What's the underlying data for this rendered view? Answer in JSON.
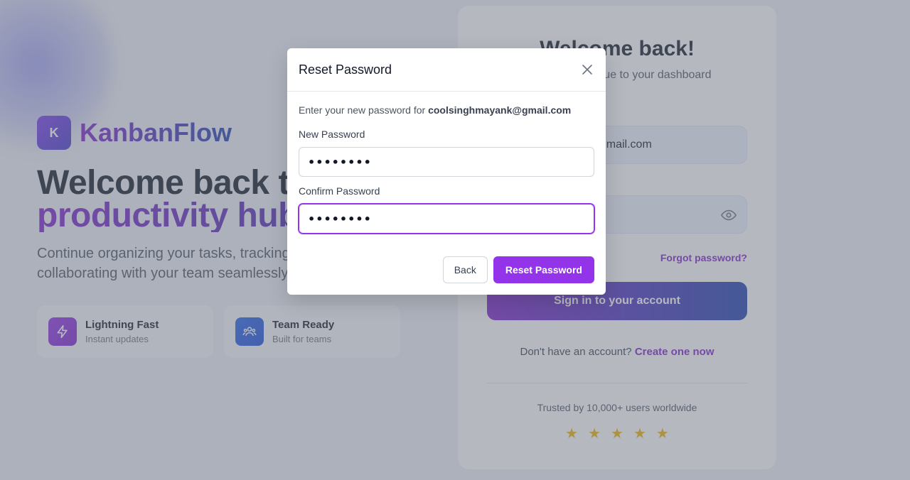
{
  "brand": {
    "logo_letter": "K",
    "name": "KanbanFlow"
  },
  "hero": {
    "title_line1": "Welcome back to your",
    "title_line2": "productivity hub",
    "subtitle": "Continue organizing your tasks, tracking progress, and collaborating with your team seamlessly."
  },
  "features": [
    {
      "title": "Lightning Fast",
      "subtitle": "Instant updates",
      "icon": "lightning-icon"
    },
    {
      "title": "Team Ready",
      "subtitle": "Built for teams",
      "icon": "team-icon"
    }
  ],
  "card": {
    "title": "Welcome back!",
    "subtitle": "Sign in to continue to your dashboard",
    "email_value": "coolsinghmayank@gmail.com",
    "forgot_label": "Forgot password?",
    "signin_label": "Sign in to your account",
    "no_account_text": "Don't have an account?",
    "create_link": "Create one now",
    "trusted_text": "Trusted by 10,000+ users worldwide",
    "stars": "★★★★★",
    "star_rating": 5
  },
  "modal": {
    "title": "Reset Password",
    "description_prefix": "Enter your new password for",
    "email": "coolsinghmayank@gmail.com",
    "new_password_label": "New Password",
    "new_password_value": "••••••••",
    "confirm_password_label": "Confirm Password",
    "confirm_password_value": "••••••••",
    "back_label": "Back",
    "reset_label": "Reset Password"
  },
  "colors": {
    "accent": "#9333ea",
    "brand_gradient_start": "#7e22ce",
    "brand_gradient_end": "#1e40af",
    "star": "#eab308"
  }
}
